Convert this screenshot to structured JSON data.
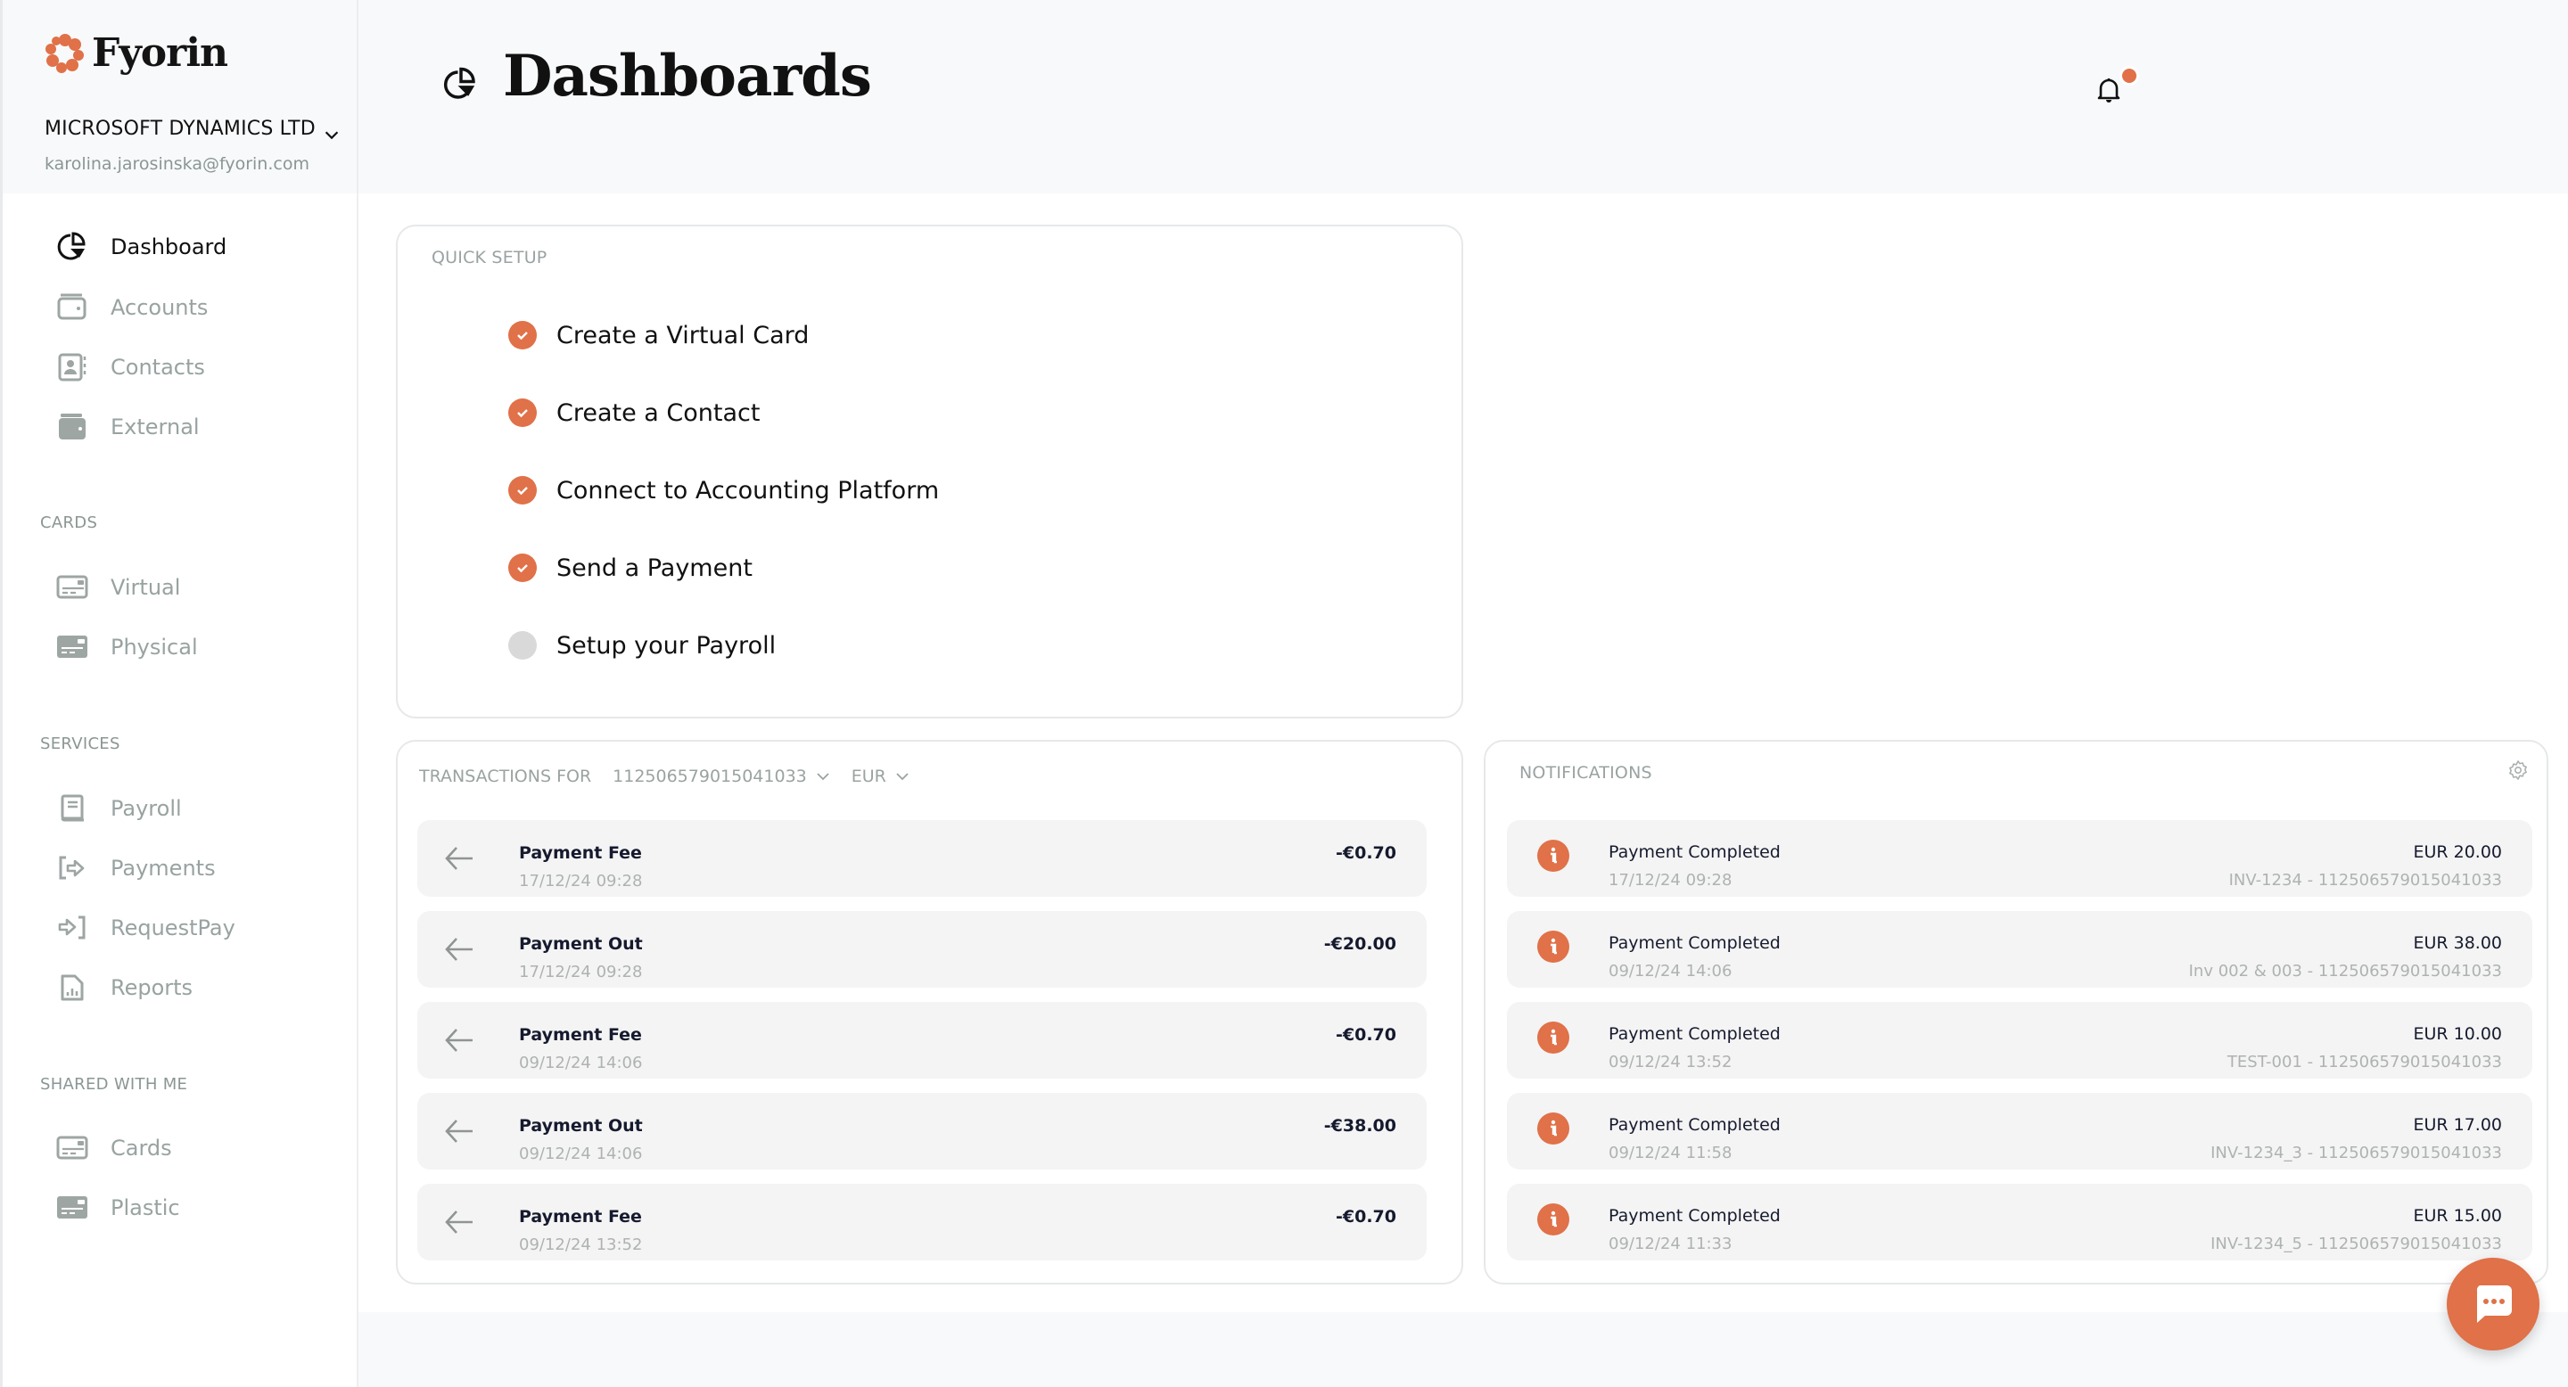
{
  "brand": {
    "name": "Fyorin",
    "accent": "#e07148"
  },
  "account": {
    "company": "MICROSOFT DYNAMICS LTD",
    "email": "karolina.jarosinska@fyorin.com"
  },
  "sidebar": {
    "main": [
      {
        "label": "Dashboard",
        "icon": "pie-chart-icon",
        "active": true
      },
      {
        "label": "Accounts",
        "icon": "wallet-outline-icon"
      },
      {
        "label": "Contacts",
        "icon": "contact-book-icon"
      },
      {
        "label": "External",
        "icon": "wallet-filled-icon"
      }
    ],
    "cards_heading": "CARDS",
    "cards": [
      {
        "label": "Virtual",
        "icon": "card-outline-icon"
      },
      {
        "label": "Physical",
        "icon": "card-filled-icon"
      }
    ],
    "services_heading": "SERVICES",
    "services": [
      {
        "label": "Payroll",
        "icon": "payroll-book-icon"
      },
      {
        "label": "Payments",
        "icon": "payment-out-icon"
      },
      {
        "label": "RequestPay",
        "icon": "payment-in-icon"
      },
      {
        "label": "Reports",
        "icon": "report-file-icon"
      }
    ],
    "shared_heading": "SHARED WITH ME",
    "shared": [
      {
        "label": "Cards",
        "icon": "card-outline-icon"
      },
      {
        "label": "Plastic",
        "icon": "card-filled-icon"
      }
    ]
  },
  "header": {
    "title": "Dashboards",
    "notification_dot": true
  },
  "quick_setup": {
    "title": "QUICK SETUP",
    "items": [
      {
        "label": "Create a Virtual Card",
        "done": true
      },
      {
        "label": "Create a Contact",
        "done": true
      },
      {
        "label": "Connect to Accounting Platform",
        "done": true
      },
      {
        "label": "Send a Payment",
        "done": true
      },
      {
        "label": "Setup your Payroll",
        "done": false
      }
    ]
  },
  "transactions": {
    "title": "TRANSACTIONS FOR",
    "account": "112506579015041033",
    "currency": "EUR",
    "rows": [
      {
        "title": "Payment Fee",
        "date": "17/12/24 09:28",
        "amount": "-€0.70"
      },
      {
        "title": "Payment Out",
        "date": "17/12/24 09:28",
        "amount": "-€20.00"
      },
      {
        "title": "Payment Fee",
        "date": "09/12/24 14:06",
        "amount": "-€0.70"
      },
      {
        "title": "Payment Out",
        "date": "09/12/24 14:06",
        "amount": "-€38.00"
      },
      {
        "title": "Payment Fee",
        "date": "09/12/24 13:52",
        "amount": "-€0.70"
      }
    ]
  },
  "notifications": {
    "title": "NOTIFICATIONS",
    "rows": [
      {
        "title": "Payment Completed",
        "date": "17/12/24 09:28",
        "amount": "EUR 20.00",
        "ref": "INV-1234 - 112506579015041033"
      },
      {
        "title": "Payment Completed",
        "date": "09/12/24 14:06",
        "amount": "EUR 38.00",
        "ref": "Inv 002 & 003 - 112506579015041033"
      },
      {
        "title": "Payment Completed",
        "date": "09/12/24 13:52",
        "amount": "EUR 10.00",
        "ref": "TEST-001 - 112506579015041033"
      },
      {
        "title": "Payment Completed",
        "date": "09/12/24 11:58",
        "amount": "EUR 17.00",
        "ref": "INV-1234_3 - 112506579015041033"
      },
      {
        "title": "Payment Completed",
        "date": "09/12/24 11:33",
        "amount": "EUR 15.00",
        "ref": "INV-1234_5 - 112506579015041033"
      }
    ]
  }
}
